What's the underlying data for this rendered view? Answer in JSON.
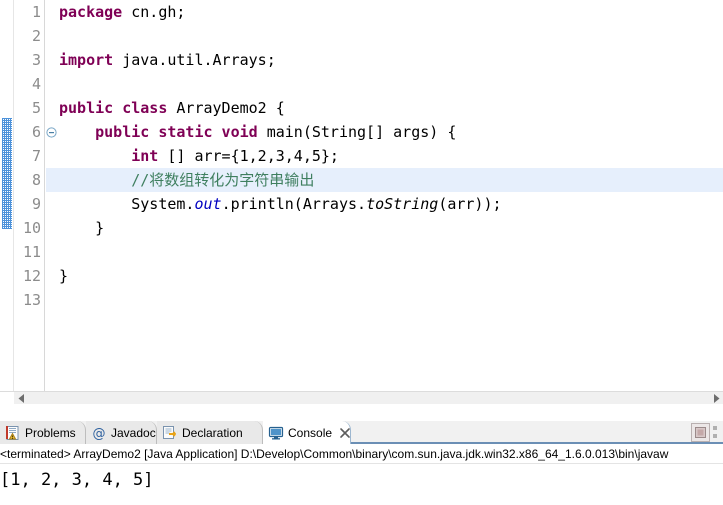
{
  "editor": {
    "name": "java-editor",
    "line_numbers": [
      "1",
      "2",
      "3",
      "4",
      "5",
      "6",
      "7",
      "8",
      "9",
      "10",
      "11",
      "12",
      "13"
    ],
    "highlighted_line": 8,
    "folding_marker_line": 6,
    "folding_icon": "collapse-minus-icon",
    "change_bar_lines": "6-10",
    "colors": {
      "keyword": "#7f0055",
      "comment": "#3f7f5f",
      "field": "#0000c0",
      "plain": "#000000",
      "line_number": "#8c8c8c",
      "current_line_highlight": "#e6effc"
    },
    "code": [
      {
        "n": "1",
        "tokens": [
          {
            "t": "kw",
            "s": "package"
          },
          {
            "t": "pln",
            "s": " cn.gh;"
          }
        ]
      },
      {
        "n": "2",
        "tokens": []
      },
      {
        "n": "3",
        "tokens": [
          {
            "t": "kw",
            "s": "import"
          },
          {
            "t": "pln",
            "s": " java.util.Arrays;"
          }
        ]
      },
      {
        "n": "4",
        "tokens": []
      },
      {
        "n": "5",
        "tokens": [
          {
            "t": "kw",
            "s": "public class"
          },
          {
            "t": "pln",
            "s": " ArrayDemo2 {"
          }
        ]
      },
      {
        "n": "6",
        "tokens": [
          {
            "t": "pln",
            "s": "    "
          },
          {
            "t": "kw",
            "s": "public static void"
          },
          {
            "t": "pln",
            "s": " main(String[] args) {"
          }
        ]
      },
      {
        "n": "7",
        "tokens": [
          {
            "t": "pln",
            "s": "        "
          },
          {
            "t": "kw",
            "s": "int"
          },
          {
            "t": "pln",
            "s": " [] arr={1,2,3,4,5};"
          }
        ]
      },
      {
        "n": "8",
        "tokens": [
          {
            "t": "pln",
            "s": "        "
          },
          {
            "t": "cmt",
            "s": "//将数组转化为字符串输出"
          }
        ]
      },
      {
        "n": "9",
        "tokens": [
          {
            "t": "pln",
            "s": "        System."
          },
          {
            "t": "fld",
            "s": "out"
          },
          {
            "t": "pln",
            "s": ".println(Arrays."
          },
          {
            "t": "mth",
            "s": "toString"
          },
          {
            "t": "pln",
            "s": "(arr));"
          }
        ]
      },
      {
        "n": "10",
        "tokens": [
          {
            "t": "pln",
            "s": "    }"
          }
        ]
      },
      {
        "n": "11",
        "tokens": []
      },
      {
        "n": "12",
        "tokens": [
          {
            "t": "pln",
            "s": "}"
          }
        ]
      },
      {
        "n": "13",
        "tokens": []
      }
    ]
  },
  "bottom_panel": {
    "tabs": [
      {
        "label": "Problems",
        "icon": "problems-icon",
        "active": false,
        "closable": false
      },
      {
        "label": "Javadoc",
        "icon": "javadoc-at-icon",
        "active": false,
        "closable": false
      },
      {
        "label": "Declaration",
        "icon": "declaration-icon",
        "active": false,
        "closable": false
      },
      {
        "label": "Console",
        "icon": "console-icon",
        "active": true,
        "closable": true
      }
    ],
    "toolbar": [
      {
        "name": "terminate-button",
        "icon": "stop-square-icon",
        "enabled": false
      }
    ],
    "console": {
      "status_line": "<terminated> ArrayDemo2 [Java Application] D:\\Develop\\Common\\binary\\com.sun.java.jdk.win32.x86_64_1.6.0.013\\bin\\javaw",
      "output": "[1, 2, 3, 4, 5]"
    }
  }
}
